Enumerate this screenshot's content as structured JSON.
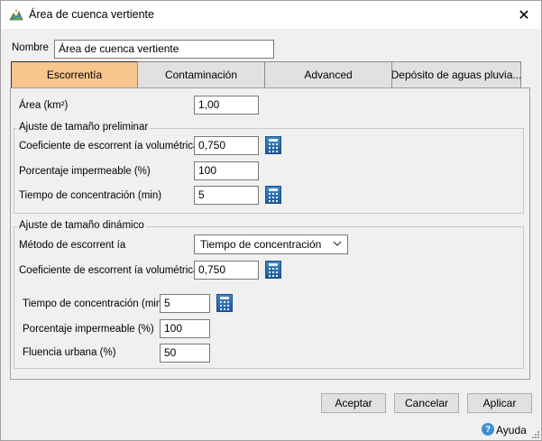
{
  "window": {
    "title": "Área de cuenca vertiente",
    "close_glyph": "✕"
  },
  "icons": {
    "app": "watershed-app-icon",
    "close": "close-icon",
    "calculator": "calculator-icon",
    "dropdown": "chevron-down-icon",
    "help": "help-icon"
  },
  "colors": {
    "active_tab": "#f8c58c",
    "calculator": "#2a6db0",
    "help": "#3b8fd1"
  },
  "name_field": {
    "label": "Nombre",
    "value": "Área de cuenca vertiente"
  },
  "tabs": [
    {
      "label": "Escorrentía",
      "active": true
    },
    {
      "label": "Contaminación",
      "active": false
    },
    {
      "label": "Advanced",
      "active": false
    },
    {
      "label": "Depósito de aguas pluvia...",
      "active": false
    }
  ],
  "area": {
    "label": "Área (km²)",
    "value": "1,00"
  },
  "preliminary": {
    "title": "Ajuste de tamaño preliminar",
    "runoff_coef": {
      "label": "Coeficiente de escorrent ía volumétrica",
      "value": "0,750"
    },
    "impervious": {
      "label": "Porcentaje impermeable (%)",
      "value": "100"
    },
    "conc_time": {
      "label": "Tiempo de concentración (min)",
      "value": "5"
    }
  },
  "dynamic": {
    "title": "Ajuste de tamaño dinámico",
    "method": {
      "label": "Método de escorrent ía",
      "value": "Tiempo de concentración"
    },
    "runoff_coef": {
      "label": "Coeficiente de escorrent ía volumétrica",
      "value": "0,750"
    },
    "conc_time": {
      "label": "Tiempo de concentración (min)",
      "value": "5"
    },
    "impervious": {
      "label": "Porcentaje impermeable (%)",
      "value": "100"
    },
    "urban_flow": {
      "label": "Fluencia urbana (%)",
      "value": "50"
    }
  },
  "buttons": {
    "accept": "Aceptar",
    "cancel": "Cancelar",
    "apply": "Aplicar"
  },
  "help": {
    "label": "Ayuda",
    "glyph": "?"
  }
}
